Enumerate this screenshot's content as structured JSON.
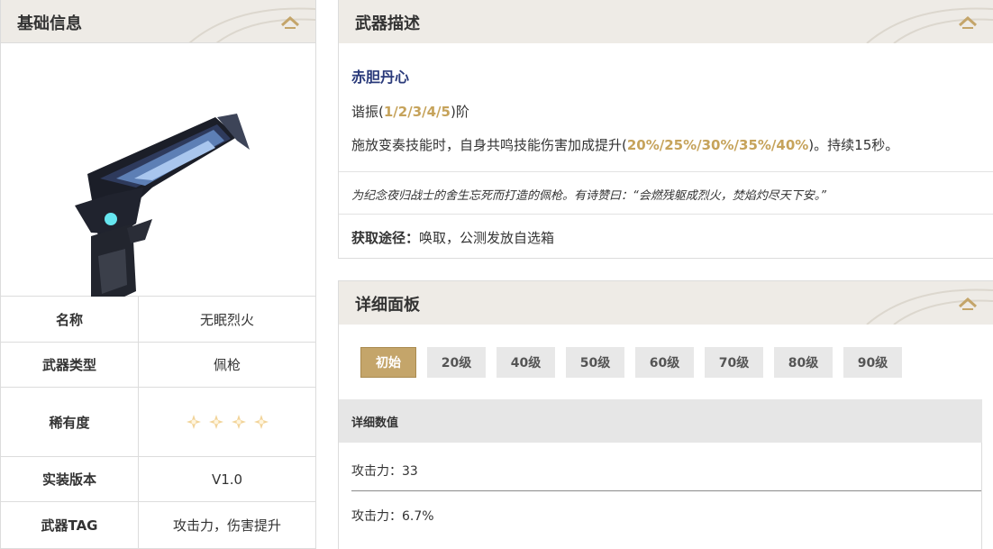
{
  "basic": {
    "title": "基础信息",
    "rows": [
      {
        "key": "名称",
        "value": "无眠烈火"
      },
      {
        "key": "武器类型",
        "value": "佩枪"
      },
      {
        "key": "稀有度",
        "stars": 4
      },
      {
        "key": "实装版本",
        "value": "V1.0"
      },
      {
        "key": "武器TAG",
        "value": "攻击力，伤害提升"
      }
    ]
  },
  "desc": {
    "title": "武器描述",
    "name": "赤胆丹心",
    "resonance_prefix": "谐振(",
    "resonance_levels": "1/2/3/4/5",
    "resonance_suffix": ")阶",
    "effect_prefix": "施放变奏技能时，自身共鸣技能伤害加成提升(",
    "effect_values": "20%/25%/30%/35%/40%",
    "effect_suffix": ")。持续15秒。",
    "lore": "为纪念夜归战士的舍生忘死而打造的佩枪。有诗赞曰：“会燃残躯成烈火，焚焰灼尽天下安。”",
    "obtain_label": "获取途径：",
    "obtain_value": "唤取，公测发放自选箱"
  },
  "detail": {
    "title": "详细面板",
    "levels": [
      "初始",
      "20级",
      "40级",
      "50级",
      "60级",
      "70级",
      "80级",
      "90级"
    ],
    "active_level": "初始",
    "stats_header": "详细数值",
    "stats": [
      "攻击力：33",
      "攻击力：6.7%"
    ]
  },
  "colors": {
    "accent": "#c4a56a",
    "header_bg": "#eeebe6",
    "title_blue": "#2a3a7a",
    "gold_text": "#c6a35b"
  },
  "icons": {
    "collapse": "chevron-up-icon",
    "rarity": "star-icon",
    "weapon": "pistol-image"
  }
}
